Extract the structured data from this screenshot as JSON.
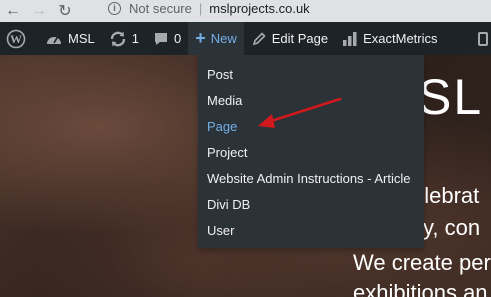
{
  "browser": {
    "back_icon": "arrow-left-icon",
    "forward_icon": "arrow-right-icon",
    "security_label": "Not secure",
    "separator": "|",
    "url": "mslprojects.co.uk"
  },
  "adminbar": {
    "items": [
      {
        "icon": "wordpress-logo-icon",
        "label": ""
      },
      {
        "icon": "dashboard-icon",
        "label": "MSL"
      },
      {
        "icon": "updates-icon",
        "label": "1"
      },
      {
        "icon": "comments-icon",
        "label": "0"
      },
      {
        "icon": "plus-icon",
        "label": "New"
      },
      {
        "icon": "pencil-icon",
        "label": "Edit Page"
      },
      {
        "icon": "bar-chart-icon",
        "label": "ExactMetrics"
      }
    ]
  },
  "new_menu": {
    "items": [
      "Post",
      "Media",
      "Page",
      "Project",
      "Website Admin Instructions - Article",
      "Divi DB",
      "User"
    ],
    "highlighted": "Page"
  },
  "hero": {
    "logo_text": "SL",
    "line1": "elebrat",
    "line2": "ity, con",
    "line3": "We create per",
    "line4": "exhibitions an"
  },
  "colors": {
    "adminbar_bg": "#1d2327",
    "submenu_bg": "#2c3338",
    "highlight": "#72aee6",
    "annotation_arrow": "#d0191d"
  }
}
